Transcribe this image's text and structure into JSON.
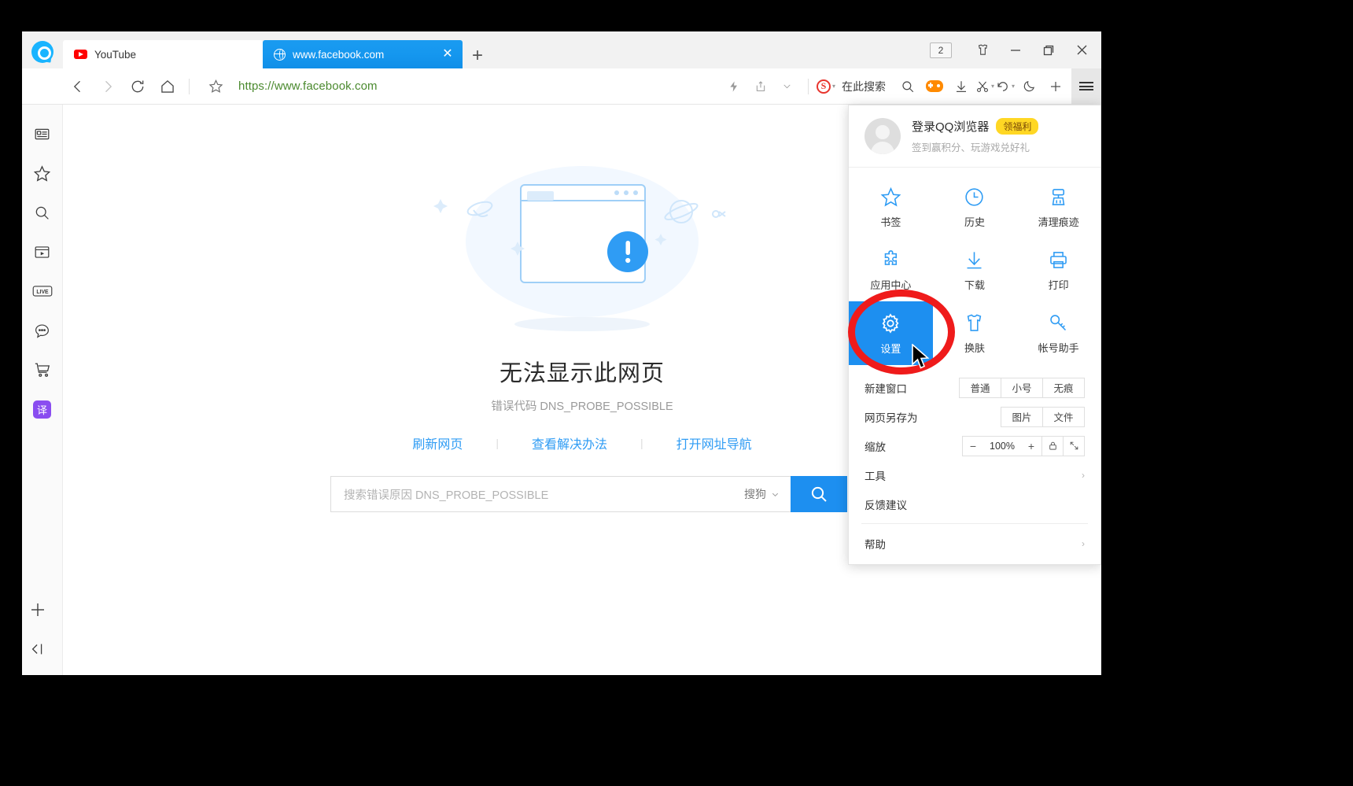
{
  "window": {
    "tabs": [
      {
        "title": "YouTube",
        "icon": "youtube-icon",
        "active": false
      },
      {
        "title": "www.facebook.com",
        "icon": "globe-icon",
        "active": true
      }
    ],
    "new_tab_label": "+",
    "tab_count_badge": "2",
    "controls": {
      "minimize": "−",
      "maximize": "❐",
      "close": "✕"
    }
  },
  "toolbar": {
    "back": "back-arrow",
    "forward": "forward-arrow",
    "reload": "reload-icon",
    "home": "home-icon",
    "bookmark_star": "star-icon",
    "url": "https://www.facebook.com",
    "lightning": "lightning-icon",
    "share": "share-icon",
    "more_caret": "⌄",
    "engine_letter": "S",
    "search_hint": "在此搜索",
    "search_icon": "search-icon",
    "game_icon": "gamepad-icon",
    "download_icon": "download-icon",
    "scissors_icon": "scissors-icon",
    "undo_icon": "undo-icon",
    "moon_icon": "moon-icon",
    "plus_icon": "plus-icon",
    "menu_icon": "hamburger-icon"
  },
  "sidebar": {
    "items": [
      {
        "name": "news",
        "icon": "news-card-icon"
      },
      {
        "name": "favorites",
        "icon": "star-icon"
      },
      {
        "name": "search",
        "icon": "search-icon"
      },
      {
        "name": "video",
        "icon": "video-player-icon"
      },
      {
        "name": "live",
        "icon": "live-icon",
        "label": "LIVE"
      },
      {
        "name": "chat",
        "icon": "chat-bubble-icon"
      },
      {
        "name": "cart",
        "icon": "shopping-cart-icon"
      },
      {
        "name": "translate",
        "icon": "translate-icon",
        "label": "译"
      }
    ],
    "bottom": [
      {
        "name": "add",
        "icon": "plus-icon"
      },
      {
        "name": "collapse",
        "icon": "collapse-icon"
      }
    ]
  },
  "error_page": {
    "title": "无法显示此网页",
    "code_text": "错误代码 DNS_PROBE_POSSIBLE",
    "links": [
      "刷新网页",
      "查看解决办法",
      "打开网址导航"
    ],
    "divider": "|",
    "search_placeholder": "搜索错误原因 DNS_PROBE_POSSIBLE",
    "search_engine": "搜狗",
    "engine_caret": "⌄",
    "search_button_icon": "search-icon"
  },
  "menu": {
    "account": {
      "name": "登录QQ浏览器",
      "badge": "领福利",
      "subtitle": "签到赢积分、玩游戏兑好礼",
      "avatar": "avatar-placeholder"
    },
    "grid": [
      {
        "label": "书签",
        "icon": "star-icon",
        "selected": false
      },
      {
        "label": "历史",
        "icon": "clock-icon",
        "selected": false
      },
      {
        "label": "清理痕迹",
        "icon": "broom-icon",
        "selected": false
      },
      {
        "label": "应用中心",
        "icon": "puzzle-icon",
        "selected": false
      },
      {
        "label": "下载",
        "icon": "download-icon",
        "selected": false
      },
      {
        "label": "打印",
        "icon": "printer-icon",
        "selected": false
      },
      {
        "label": "设置",
        "icon": "gear-icon",
        "selected": true
      },
      {
        "label": "换肤",
        "icon": "tshirt-icon",
        "selected": false
      },
      {
        "label": "帐号助手",
        "icon": "key-icon",
        "selected": false
      }
    ],
    "rows": {
      "new_window": {
        "label": "新建窗口",
        "options": [
          "普通",
          "小号",
          "无痕"
        ]
      },
      "save_as": {
        "label": "网页另存为",
        "options": [
          "图片",
          "文件"
        ]
      },
      "zoom": {
        "label": "缩放",
        "minus": "−",
        "value": "100%",
        "plus": "+",
        "lock_icon": "lock-icon",
        "fullscreen_icon": "fullscreen-icon"
      },
      "tools": {
        "label": "工具",
        "chevron": "›"
      },
      "feedback": {
        "label": "反馈建议"
      },
      "help": {
        "label": "帮助",
        "chevron": "›"
      }
    }
  },
  "colors": {
    "accent_blue": "#1d8ff0",
    "tab_active": "#1597ef",
    "link_blue": "#2f9cf4",
    "badge_yellow": "#ffd724",
    "highlight_red": "#ef1b1b",
    "url_green": "#4b8a2f",
    "translate_purple": "#8a4df0",
    "game_orange": "#ff8a00"
  }
}
